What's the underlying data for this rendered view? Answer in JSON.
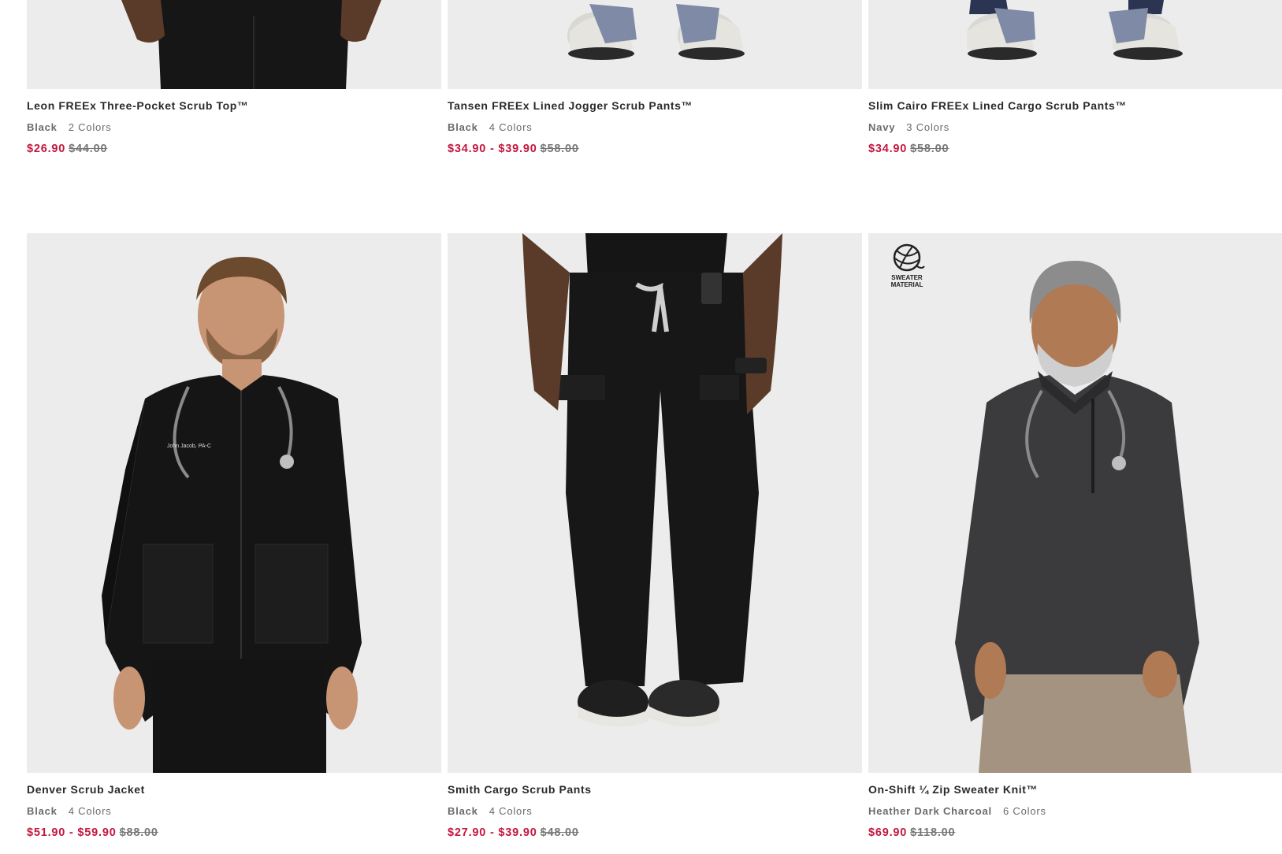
{
  "products": [
    {
      "name": "Leon FREEx Three-Pocket Scrub Top™",
      "color": "Black",
      "colors": "2 Colors",
      "sale": "$26.90",
      "orig": "$44.00",
      "image": "model-bottom-black-pants"
    },
    {
      "name": "Tansen FREEx Lined Jogger Scrub Pants™",
      "color": "Black",
      "colors": "4 Colors",
      "sale": "$34.90 - $39.90",
      "orig": "$58.00",
      "image": "model-feet-sneakers"
    },
    {
      "name": "Slim Cairo FREEx Lined Cargo Scrub Pants™",
      "color": "Navy",
      "colors": "3 Colors",
      "sale": "$34.90",
      "orig": "$58.00",
      "image": "model-feet-sneakers"
    },
    {
      "name": "Denver Scrub Jacket",
      "color": "Black",
      "colors": "4 Colors",
      "sale": "$51.90 - $59.90",
      "orig": "$88.00",
      "image": "model-black-scrub-jacket"
    },
    {
      "name": "Smith Cargo Scrub Pants",
      "color": "Black",
      "colors": "4 Colors",
      "sale": "$27.90 - $39.90",
      "orig": "$48.00",
      "image": "model-black-cargo-pants"
    },
    {
      "name": "On-Shift ¼ Zip Sweater Knit™",
      "color": "Heather Dark Charcoal",
      "colors": "6 Colors",
      "sale": "$69.90",
      "orig": "$118.00",
      "image": "model-charcoal-sweater",
      "badge": [
        "SWEATER",
        "MATERIAL"
      ]
    }
  ],
  "colors": {
    "sale": "#c3173f",
    "image_bg": "#ececec"
  }
}
